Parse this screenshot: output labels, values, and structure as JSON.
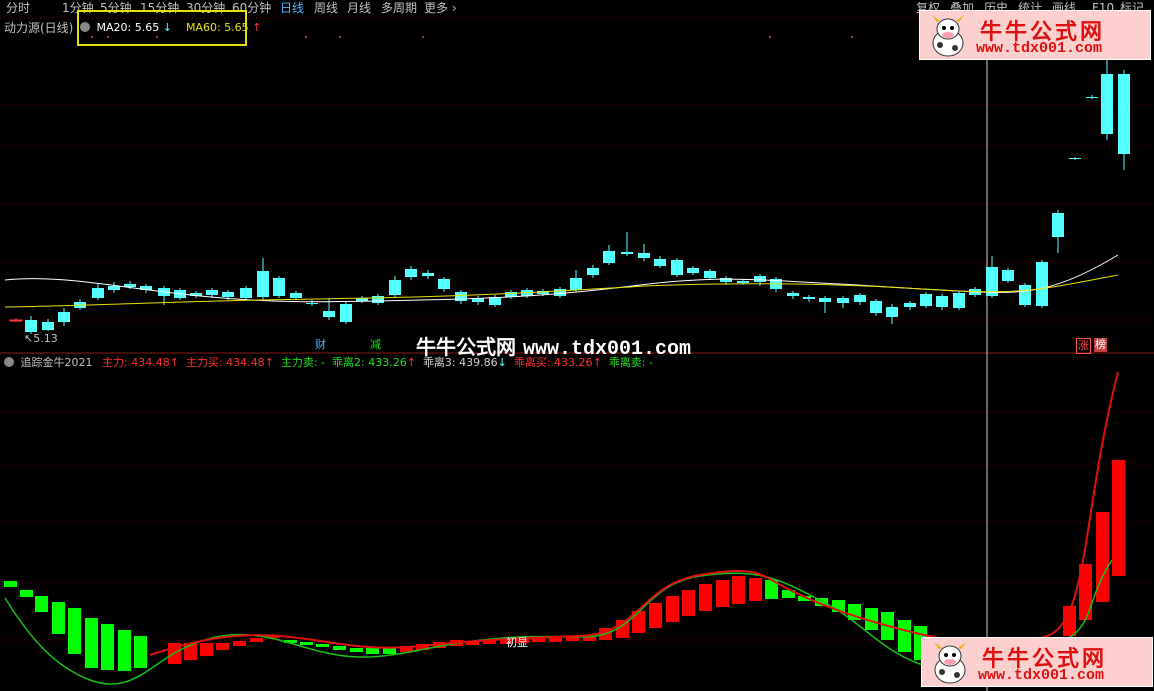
{
  "toolbar": {
    "periods": [
      "分时",
      "1分钟",
      "5分钟",
      "15分钟",
      "30分钟",
      "60分钟",
      "日线",
      "周线",
      "月线",
      "多周期",
      "更多"
    ],
    "active": "日线",
    "right_items": [
      "复权",
      "叠加",
      "历史",
      "统计",
      "画线",
      "F10",
      "标记"
    ]
  },
  "main_panel": {
    "title": "动力源(日线)",
    "ma20_label": "MA20: 5.65",
    "ma20_arrow": "↓",
    "ma60_label": "MA60: 5.65",
    "ma60_arrow": "↑",
    "low_marker": "5.13",
    "event_tags": {
      "cai": "财",
      "jian": "减",
      "zhang": "涨",
      "bang": "榜"
    }
  },
  "indicator_panel": {
    "title": "追踪金牛2021",
    "items": [
      {
        "label": "主力: 434.48",
        "arrow": "↑",
        "color": "#ff3030"
      },
      {
        "label": "主力买: 434.48",
        "arrow": "↑",
        "color": "#ff3030"
      },
      {
        "label": "主力卖: -",
        "arrow": "",
        "color": "#20e020"
      },
      {
        "label": "乖离2: 433.26",
        "arrow": "↑",
        "color": "#20e020"
      },
      {
        "label": "乖离3: 439.86",
        "arrow": "↓",
        "color": "#d0d0d0"
      },
      {
        "label": "乖离买: 433.26",
        "arrow": "↑",
        "color": "#ff3030"
      },
      {
        "label": "乖离卖: -",
        "arrow": "",
        "color": "#20e020"
      }
    ],
    "signal_label": "初显"
  },
  "watermark": {
    "cn": "牛牛公式网",
    "url": "www.tdx001.com"
  },
  "logo": {
    "title": "牛牛公式网",
    "url": "www.tdx001.com"
  },
  "colors": {
    "up": "#ff3c3c",
    "down": "#54ffff",
    "ma20": "#ffffff",
    "ma60": "#e8e000",
    "bar_green": "#00ff00",
    "bar_red": "#ff0000",
    "line_red": "#e01010",
    "line_green": "#18c018",
    "highlight": "#e8e000"
  }
}
